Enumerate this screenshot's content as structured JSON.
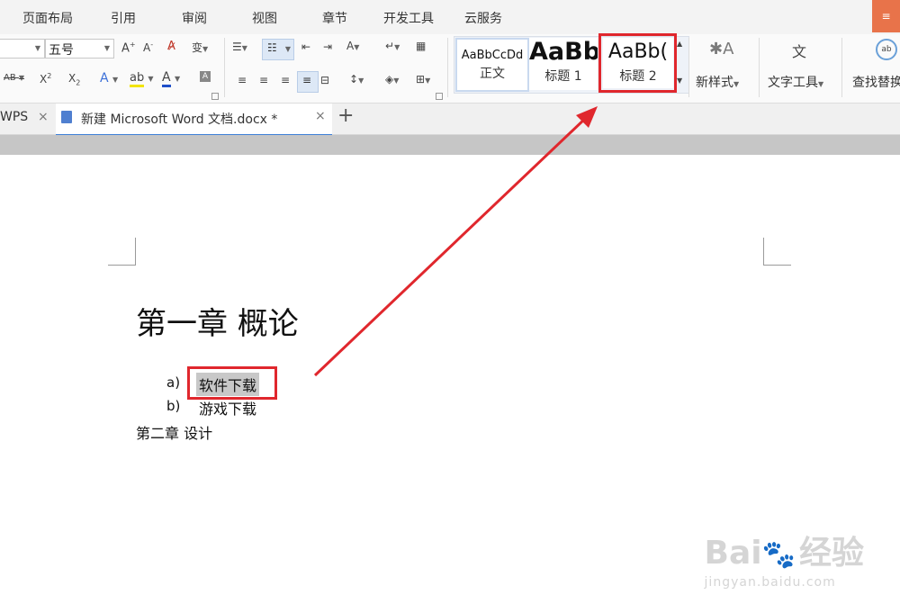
{
  "menu": {
    "tabs": [
      "页面布局",
      "引用",
      "审阅",
      "视图",
      "章节",
      "开发工具",
      "云服务"
    ],
    "corner_label": "≡"
  },
  "ribbon": {
    "font_size": "五号",
    "styles": [
      {
        "sample": "AaBbCcDd",
        "name": "正文"
      },
      {
        "sample": "AaBb",
        "name": "标题 1"
      },
      {
        "sample": "AaBb(",
        "name": "标题 2"
      }
    ],
    "new_style_label": "新样式",
    "text_tools_label": "文字工具",
    "find_replace_label": "查找替换",
    "font_color_hex": "#1f4fc9",
    "highlight_color_hex": "#f2e400"
  },
  "tabs": {
    "left_tab_label": "WPS",
    "active_doc_label": "新建 Microsoft Word 文档.docx *",
    "add_tab_symbol": "+"
  },
  "document": {
    "heading": "第一章  概论",
    "list": [
      {
        "marker": "a)",
        "text": "软件下载"
      },
      {
        "marker": "b)",
        "text": "游戏下载"
      }
    ],
    "chapter2": "第二章  设计"
  },
  "annotation": {
    "color_hex": "#e0272d"
  },
  "watermark": {
    "brand": "Bai",
    "brand_suffix": "经验",
    "url": "jingyan.baidu.com"
  }
}
